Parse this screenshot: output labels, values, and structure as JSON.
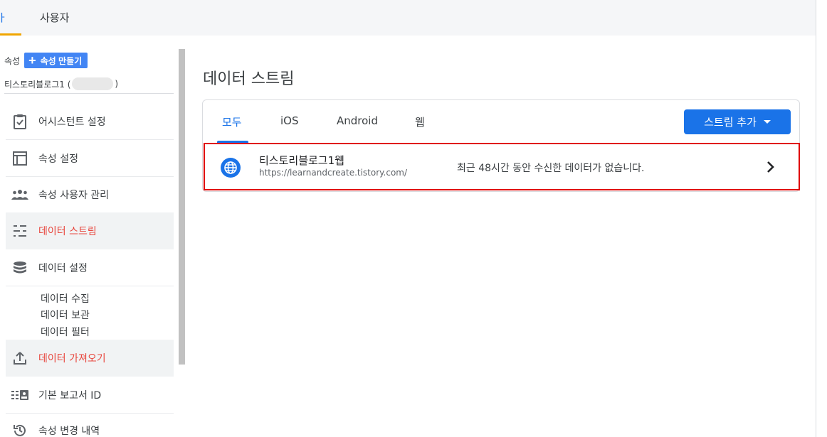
{
  "top_tabs": {
    "partial_label": "ㅏ",
    "users_label": "사용자"
  },
  "sidebar": {
    "property_label": "속성",
    "create_property_label": "속성 만들기",
    "property_name_prefix": "티스토리블로그1 (",
    "property_name_suffix": ")",
    "items": [
      {
        "label": "어시스턴트 설정",
        "icon": "checklist-icon"
      },
      {
        "label": "속성 설정",
        "icon": "layout-icon"
      },
      {
        "label": "속성 사용자 관리",
        "icon": "people-icon"
      },
      {
        "label": "데이터 스트림",
        "icon": "streams-icon",
        "active": true
      },
      {
        "label": "데이터 설정",
        "icon": "database-icon"
      }
    ],
    "sub_items": [
      "데이터 수집",
      "데이터 보관",
      "데이터 필터"
    ],
    "items_after": [
      {
        "label": "데이터 가져오기",
        "icon": "upload-icon",
        "active": true
      },
      {
        "label": "기본 보고서 ID",
        "icon": "report-id-icon"
      },
      {
        "label": "속성 변경 내역",
        "icon": "history-icon"
      }
    ]
  },
  "main": {
    "title": "데이터 스트림",
    "tabs": [
      "모두",
      "iOS",
      "Android",
      "웹"
    ],
    "active_tab": "모두",
    "add_stream_label": "스트림 추가",
    "stream": {
      "name": "티스토리블로그1웹",
      "url": "https://learnandcreate.tistory.com/",
      "status": "최근 48시간 동안 수신한 데이터가 없습니다."
    }
  },
  "colors": {
    "accent": "#1a73e8",
    "active_nav": "#e8453c",
    "highlight": "#e00000"
  }
}
